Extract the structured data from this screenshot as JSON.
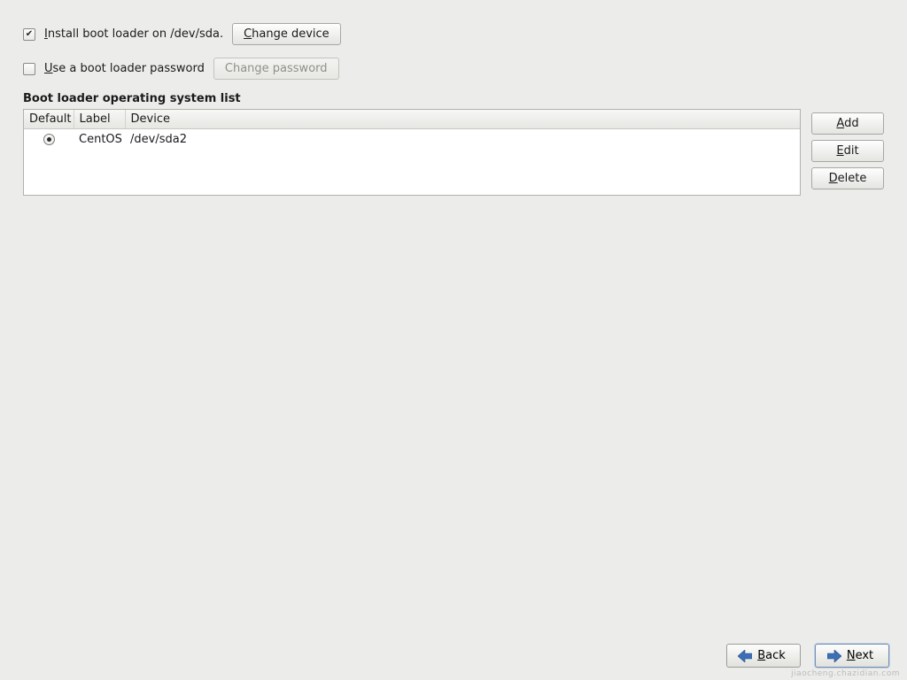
{
  "options": {
    "install_label_pre": "I",
    "install_label_rest": "nstall boot loader on /dev/sda.",
    "install_checked": true,
    "change_device_accel": "C",
    "change_device_rest": "hange device",
    "use_password_accel": "U",
    "use_password_rest": "se a boot loader password",
    "use_password_checked": false,
    "change_password_label": "Change password"
  },
  "section_title": "Boot loader operating system list",
  "table": {
    "headers": {
      "default": "Default",
      "label": "Label",
      "device": "Device"
    },
    "rows": [
      {
        "default_selected": true,
        "label": "CentOS",
        "device": "/dev/sda2"
      }
    ]
  },
  "side_buttons": {
    "add_accel": "A",
    "add_rest": "dd",
    "edit_accel": "E",
    "edit_rest": "dit",
    "delete_accel": "D",
    "delete_rest": "elete"
  },
  "footer": {
    "back_accel": "B",
    "back_rest": "ack",
    "next_accel": "N",
    "next_rest": "ext"
  },
  "watermark": "jiaocheng.chazidian.com"
}
